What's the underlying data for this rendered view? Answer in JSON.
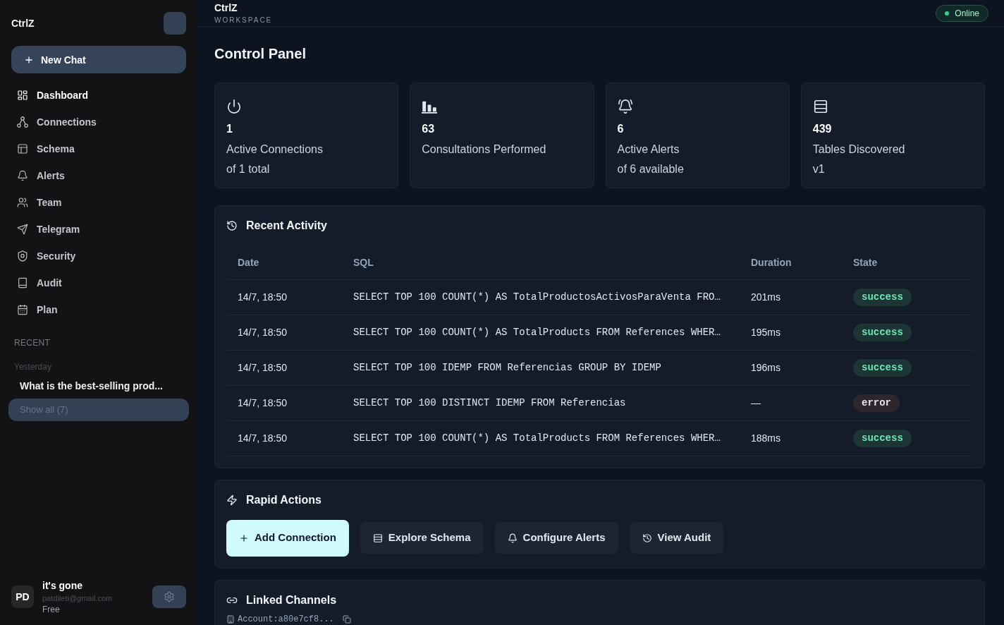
{
  "sidebar": {
    "brand": "CtrlZ",
    "new_chat": "New Chat",
    "nav": [
      {
        "label": "Dashboard",
        "selected": true
      },
      {
        "label": "Connections",
        "selected": false
      },
      {
        "label": "Schema",
        "selected": false
      },
      {
        "label": "Alerts",
        "selected": false
      },
      {
        "label": "Team",
        "selected": false
      },
      {
        "label": "Telegram",
        "selected": false
      },
      {
        "label": "Security",
        "selected": false
      },
      {
        "label": "Audit",
        "selected": false
      },
      {
        "label": "Plan",
        "selected": false
      }
    ],
    "recent": {
      "heading": "RECENT",
      "groups": [
        {
          "label": "Yesterday",
          "items": [
            {
              "title": "What is the best-selling prod..."
            }
          ]
        }
      ],
      "show_all": "Show all (7)"
    },
    "user": {
      "initials": "PD",
      "name": "it's gone",
      "email": "patdileti@gmail.com",
      "plan": "Free"
    }
  },
  "header": {
    "title": "CtrlZ",
    "subtitle": "WORKSPACE",
    "status": {
      "label": "Online",
      "online": true
    }
  },
  "page_title": "Control Panel",
  "stats": [
    {
      "value": "1",
      "label": "Active Connections",
      "note": "of 1 total"
    },
    {
      "value": "63",
      "label": "Consultations Performed"
    },
    {
      "value": "6",
      "label": "Active Alerts",
      "note": "of 6 available"
    },
    {
      "value": "439",
      "label": "Tables Discovered",
      "note": "v1"
    }
  ],
  "recent_activity": {
    "title": "Recent Activity",
    "columns": [
      "Date",
      "SQL",
      "Duration",
      "State"
    ],
    "rows": [
      {
        "date": "14/7, 18:50",
        "sql": "SELECT TOP 100 COUNT(*) AS TotalProductosActivosParaVenta FRO…",
        "duration": "201ms",
        "state": {
          "label": "success",
          "kind": "success"
        }
      },
      {
        "date": "14/7, 18:50",
        "sql": "SELECT TOP 100 COUNT(*) AS TotalProducts FROM References WHER…",
        "duration": "195ms",
        "state": {
          "label": "success",
          "kind": "success"
        }
      },
      {
        "date": "14/7, 18:50",
        "sql": "SELECT TOP 100 IDEMP FROM Referencias GROUP BY IDEMP",
        "duration": "196ms",
        "state": {
          "label": "success",
          "kind": "success"
        }
      },
      {
        "date": "14/7, 18:50",
        "sql": "SELECT TOP 100 DISTINCT IDEMP FROM Referencias",
        "duration": "—",
        "state": {
          "label": "error",
          "kind": "error"
        }
      },
      {
        "date": "14/7, 18:50",
        "sql": "SELECT TOP 100 COUNT(*) AS TotalProducts FROM References WHER…",
        "duration": "188ms",
        "state": {
          "label": "success",
          "kind": "success"
        }
      }
    ]
  },
  "rapid_actions": {
    "title": "Rapid Actions",
    "buttons": [
      {
        "label": "Add Connection",
        "highlighted": true
      },
      {
        "label": "Explore Schema",
        "highlighted": false
      },
      {
        "label": "Configure Alerts",
        "highlighted": false
      },
      {
        "label": "View Audit",
        "highlighted": false
      }
    ]
  },
  "linked_channels": {
    "title": "Linked Channels",
    "account": "Account:a80e7cf8..."
  }
}
